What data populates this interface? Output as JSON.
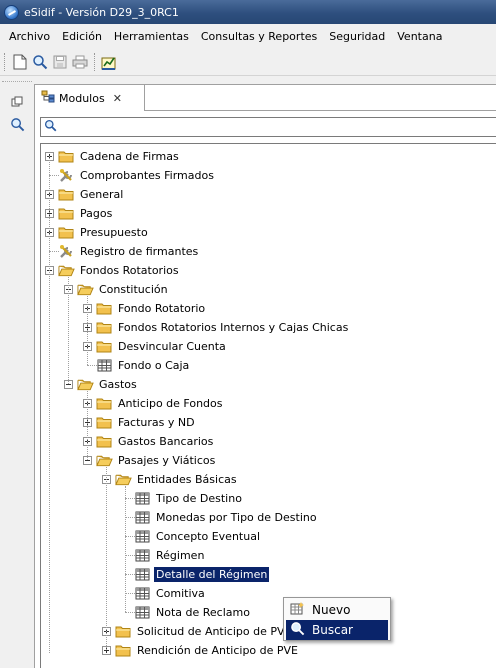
{
  "window": {
    "title": "eSidif - Versión D29_3_0RC1"
  },
  "menubar": {
    "items": [
      "Archivo",
      "Edición",
      "Herramientas",
      "Consultas y Reportes",
      "Seguridad",
      "Ventana"
    ]
  },
  "toolbar": {
    "buttons": [
      {
        "icon": "new-document-icon"
      },
      {
        "icon": "search-icon"
      },
      {
        "icon": "save-icon"
      },
      {
        "icon": "print-icon"
      },
      {
        "icon": "report-icon"
      }
    ]
  },
  "view": {
    "tab_label": "Modulos",
    "filter": {
      "value": "",
      "placeholder": ""
    }
  },
  "tree": {
    "items": [
      {
        "label": "Cadena de Firmas",
        "icon": "folder-icon",
        "state": "collapsed"
      },
      {
        "label": "Comprobantes Firmados",
        "icon": "tools-icon",
        "state": "leaf"
      },
      {
        "label": "General",
        "icon": "folder-icon",
        "state": "collapsed"
      },
      {
        "label": "Pagos",
        "icon": "folder-icon",
        "state": "collapsed"
      },
      {
        "label": "Presupuesto",
        "icon": "folder-icon",
        "state": "collapsed"
      },
      {
        "label": "Registro de firmantes",
        "icon": "tools-icon",
        "state": "leaf"
      },
      {
        "label": "Fondos Rotatorios",
        "icon": "folder-open-icon",
        "state": "expanded"
      },
      {
        "label": "Constitución",
        "icon": "folder-open-icon",
        "state": "expanded"
      },
      {
        "label": "Fondo Rotatorio",
        "icon": "folder-icon",
        "state": "collapsed"
      },
      {
        "label": "Fondos Rotatorios Internos y Cajas Chicas",
        "icon": "folder-icon",
        "state": "collapsed"
      },
      {
        "label": "Desvincular Cuenta",
        "icon": "folder-icon",
        "state": "collapsed"
      },
      {
        "label": "Fondo o Caja",
        "icon": "table-icon",
        "state": "leaf"
      },
      {
        "label": "Gastos",
        "icon": "folder-open-icon",
        "state": "expanded"
      },
      {
        "label": "Anticipo de Fondos",
        "icon": "folder-icon",
        "state": "collapsed"
      },
      {
        "label": "Facturas y ND",
        "icon": "folder-icon",
        "state": "collapsed"
      },
      {
        "label": "Gastos Bancarios",
        "icon": "folder-icon",
        "state": "collapsed"
      },
      {
        "label": "Pasajes y Viáticos",
        "icon": "folder-open-icon",
        "state": "expanded"
      },
      {
        "label": "Entidades Básicas",
        "icon": "folder-open-icon",
        "state": "expanded"
      },
      {
        "label": "Tipo de Destino",
        "icon": "table-icon",
        "state": "leaf"
      },
      {
        "label": "Monedas por Tipo de Destino",
        "icon": "table-icon",
        "state": "leaf"
      },
      {
        "label": "Concepto Eventual",
        "icon": "table-icon",
        "state": "leaf"
      },
      {
        "label": "Régimen",
        "icon": "table-icon",
        "state": "leaf"
      },
      {
        "label": "Detalle del Régimen",
        "icon": "table-icon",
        "state": "leaf",
        "selected": true
      },
      {
        "label": "Comitiva",
        "icon": "table-icon",
        "state": "leaf"
      },
      {
        "label": "Nota de Reclamo",
        "icon": "table-icon",
        "state": "leaf"
      },
      {
        "label": "Solicitud de Anticipo de PVE",
        "icon": "folder-icon",
        "state": "collapsed"
      },
      {
        "label": "Rendición de Anticipo de PVE",
        "icon": "folder-icon",
        "state": "collapsed"
      }
    ]
  },
  "context_menu": {
    "items": [
      {
        "label": "Nuevo",
        "icon": "new-table-icon"
      },
      {
        "label": "Buscar",
        "icon": "search-icon",
        "highlighted": true
      }
    ]
  },
  "colors": {
    "selection": "#0a246a",
    "titlebar": "#2e4f7e",
    "folder": "#f2c14e"
  }
}
